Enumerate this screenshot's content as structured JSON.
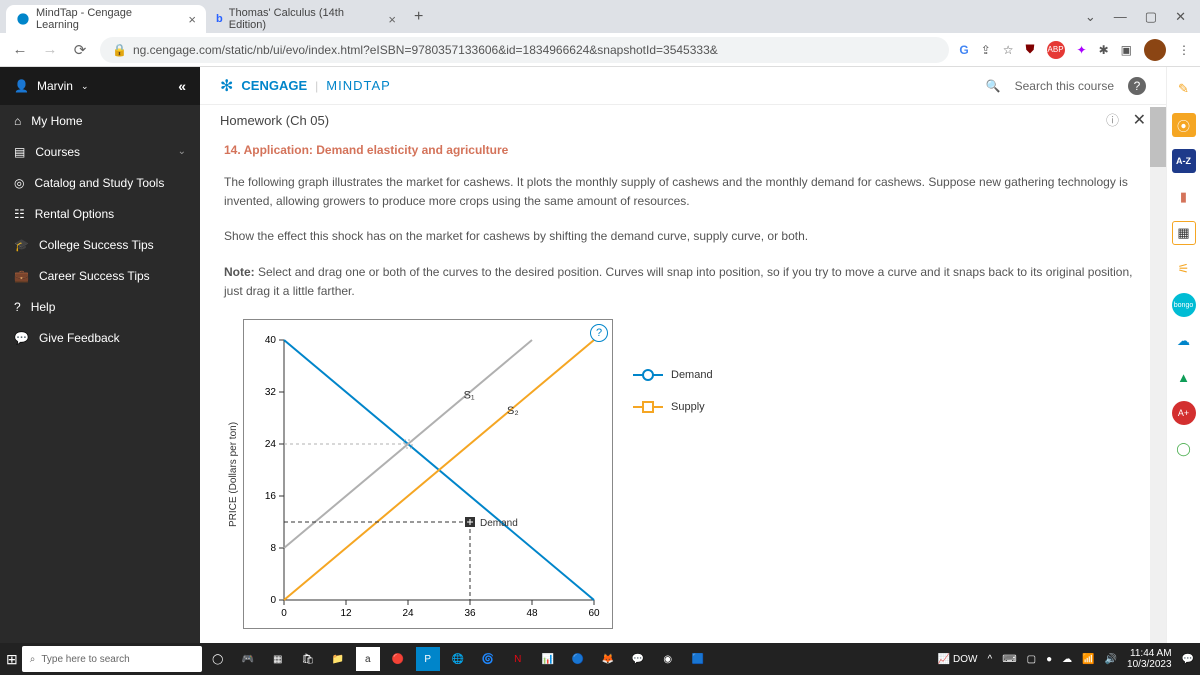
{
  "browser": {
    "tabs": [
      {
        "title": "MindTap - Cengage Learning"
      },
      {
        "title": "Thomas' Calculus (14th Edition)"
      }
    ],
    "url": "ng.cengage.com/static/nb/ui/evo/index.html?eISBN=9780357133606&id=1834966624&snapshotId=3545333&"
  },
  "sidebar": {
    "user": "Marvin",
    "items": [
      {
        "label": "My Home"
      },
      {
        "label": "Courses"
      },
      {
        "label": "Catalog and Study Tools"
      },
      {
        "label": "Rental Options"
      },
      {
        "label": "College Success Tips"
      },
      {
        "label": "Career Success Tips"
      },
      {
        "label": "Help"
      },
      {
        "label": "Give Feedback"
      }
    ]
  },
  "header": {
    "brand1": "CENGAGE",
    "brand2": "MINDTAP",
    "search": "Search this course"
  },
  "homework": {
    "title": "Homework (Ch 05)",
    "question_title": "14. Application: Demand elasticity and agriculture",
    "para1": "The following graph illustrates the market for cashews. It plots the monthly supply of cashews and the monthly demand for cashews. Suppose new gathering technology is invented, allowing growers to produce more crops using the same amount of resources.",
    "instruction": "Show the effect this shock has on the market for cashews by shifting the demand curve, supply curve, or both.",
    "note_bold": "Note:",
    "note_text": " Select and drag one or both of the curves to the desired position. Curves will snap into position, so if you try to move a curve and it snaps back to its original position, just drag it a little farther."
  },
  "chart_data": {
    "type": "line",
    "xlabel": "",
    "ylabel": "PRICE (Dollars per ton)",
    "x_ticks": [
      0,
      12,
      24,
      36,
      48,
      60
    ],
    "y_ticks": [
      0,
      8,
      16,
      24,
      32,
      40
    ],
    "xlim": [
      0,
      60
    ],
    "ylim": [
      0,
      40
    ],
    "series": [
      {
        "name": "Demand",
        "color": "#0085ca",
        "x1": 0,
        "y1": 40,
        "x2": 60,
        "y2": 0
      },
      {
        "name": "S1",
        "label": "S₁",
        "color": "#b0b0b0",
        "x1": 0,
        "y1": 8,
        "x2": 48,
        "y2": 40
      },
      {
        "name": "S2",
        "label": "S₂",
        "color": "#f5a623",
        "x1": 0,
        "y1": 0,
        "x2": 60,
        "y2": 40
      }
    ],
    "intersection_marker": {
      "x": 36,
      "y": 12,
      "label": "Demand"
    },
    "legend": [
      {
        "name": "Demand",
        "shape": "circle",
        "color": "#0085ca"
      },
      {
        "name": "Supply",
        "shape": "square",
        "color": "#f5a623"
      }
    ]
  },
  "taskbar": {
    "search": "Type here to search",
    "stock": "DOW",
    "time": "11:44 AM",
    "date": "10/3/2023"
  },
  "right_rail": {
    "az": "A-Z",
    "bongo": "bongo",
    "aplus": "A+"
  }
}
